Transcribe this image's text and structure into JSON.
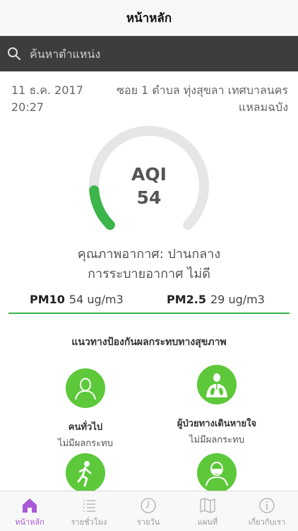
{
  "header": {
    "title": "หน้าหลัก"
  },
  "search": {
    "placeholder": "ค้นหาตำแหน่ง"
  },
  "info": {
    "date": "11 ธ.ค. 2017",
    "time": "20:27",
    "location_line1": "ซอย 1 ตำบล ทุ่งสุขลา เทศบาลนคร",
    "location_line2": "แหลมฉบัง"
  },
  "aqi": {
    "label": "AQI",
    "value": "54",
    "level": 0.15,
    "color": "#3cb54a",
    "track_color": "#e6e6e6"
  },
  "quality": {
    "line1": "คุณภาพอากาศ: ปานกลาง",
    "line2": "การระบายอากาศ ไม่ดี"
  },
  "pm": {
    "pm10_name": "PM10",
    "pm10_value": "54 ug/m3",
    "pm25_name": "PM2.5",
    "pm25_value": "29 ug/m3"
  },
  "health": {
    "title": "แนวทางป้องกันผลกระทบทางสุขภาพ",
    "items": [
      {
        "name": "คนทั่วไป",
        "effect": "ไม่มีผลกระทบ",
        "icon": "person-icon"
      },
      {
        "name": "ผู้ป่วยทางเดินหายใจ",
        "effect": "ไม่มีผลกระทบ",
        "icon": "lungs-icon"
      },
      {
        "name": "",
        "effect": "",
        "icon": "runner-icon"
      },
      {
        "name": "",
        "effect": "",
        "icon": "mask-person-icon"
      }
    ]
  },
  "tabs": [
    {
      "label": "หน้าหลัก",
      "icon": "home-icon",
      "active": true
    },
    {
      "label": "รายชั่วโมง",
      "icon": "list-icon",
      "active": false
    },
    {
      "label": "รายวัน",
      "icon": "clock-icon",
      "active": false
    },
    {
      "label": "แผนที่",
      "icon": "map-icon",
      "active": false
    },
    {
      "label": "เกี่ยวกับเรา",
      "icon": "info-icon",
      "active": false
    }
  ],
  "colors": {
    "accent": "#a85ad6",
    "icon_green": "#5cc83a",
    "search_bg": "#3d3d3d"
  }
}
